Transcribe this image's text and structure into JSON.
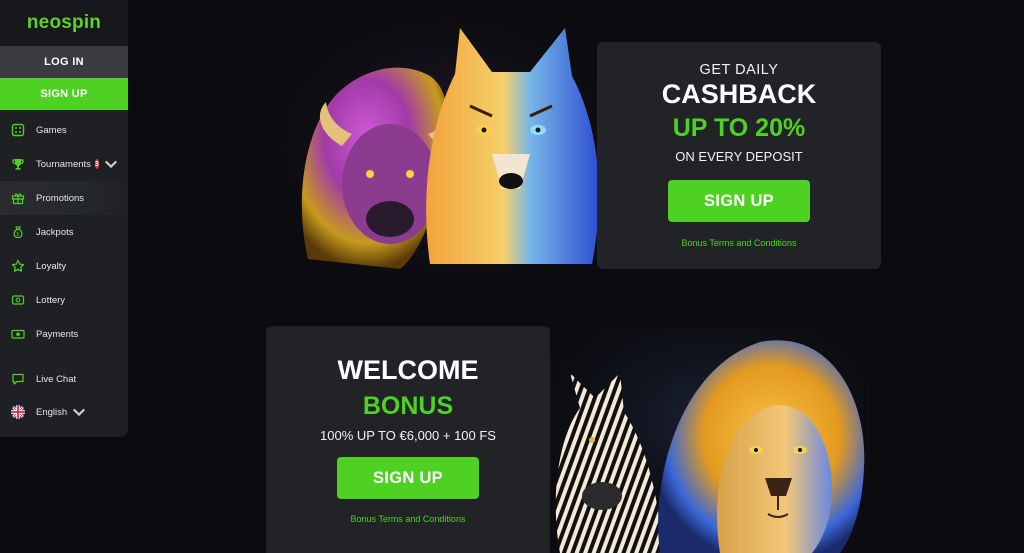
{
  "brand": {
    "logo": "neospin"
  },
  "auth": {
    "login_label": "LOG IN",
    "signup_label": "SIGN UP"
  },
  "nav": {
    "games": "Games",
    "tournaments": "Tournaments",
    "tournaments_badge": "3",
    "promotions": "Promotions",
    "jackpots": "Jackpots",
    "loyalty": "Loyalty",
    "lottery": "Lottery",
    "payments": "Payments",
    "live_chat": "Live Chat",
    "language": "English"
  },
  "promo_cashback": {
    "eyebrow": "GET DAILY",
    "title": "CASHBACK",
    "highlight": "UP TO 20%",
    "subtitle": "ON EVERY DEPOSIT",
    "cta_label": "SIGN UP",
    "terms_label": "Bonus Terms and Conditions"
  },
  "promo_welcome": {
    "title": "WELCOME",
    "highlight": "BONUS",
    "subtitle": "100% UP TO €6,000 + 100 FS",
    "cta_label": "SIGN UP",
    "terms_label": "Bonus Terms and Conditions"
  },
  "colors": {
    "brand_green": "#4fd124",
    "background": "#0c0c10",
    "panel": "#222326",
    "sidebar": "#1f2024",
    "badge_red": "#e0374a"
  },
  "icons": [
    "dice-icon",
    "trophy-icon",
    "gift-icon",
    "money-bag-icon",
    "star-icon",
    "lottery-ticket-icon",
    "cash-icon",
    "chat-icon",
    "uk-flag-icon",
    "chevron-down-icon"
  ]
}
